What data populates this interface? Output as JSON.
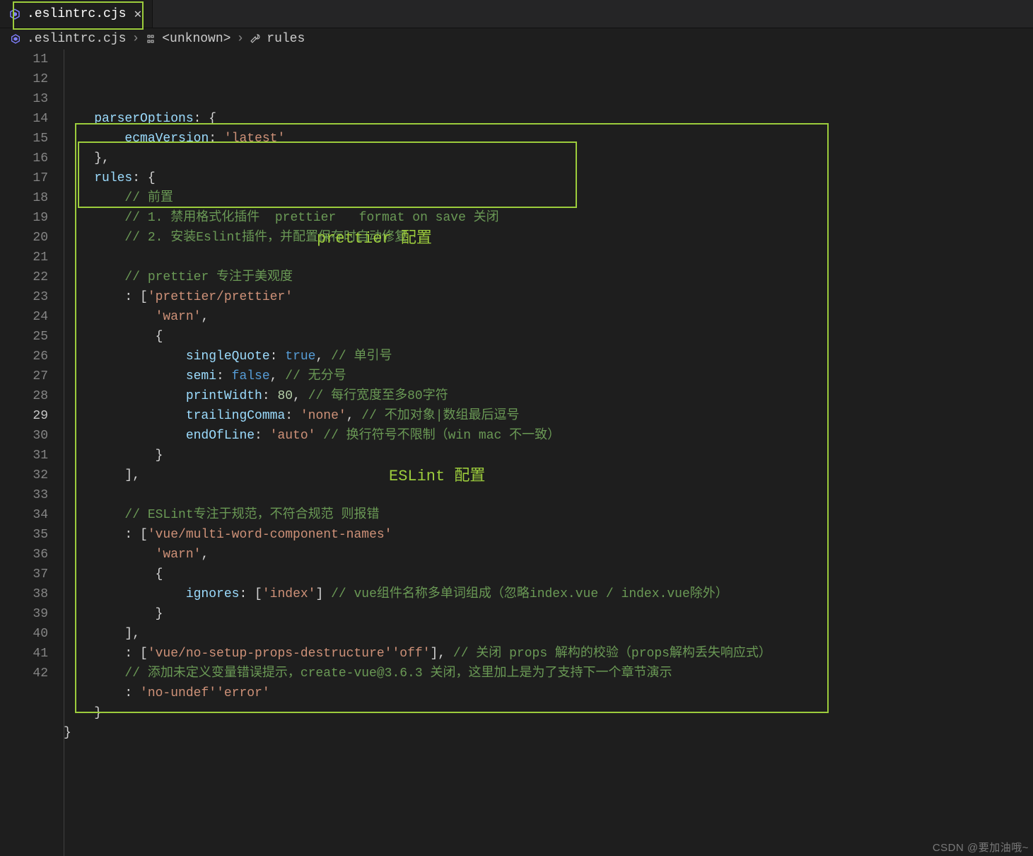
{
  "tab": {
    "filename": ".eslintrc.cjs"
  },
  "breadcrumbs": {
    "file": ".eslintrc.cjs",
    "scope": "<unknown>",
    "prop": "rules"
  },
  "lineStart": 11,
  "lineEnd": 42,
  "annotations": {
    "prettier_label": "prettier 配置",
    "eslint_label": "ESLint 配置"
  },
  "watermark": "CSDN @要加油哦~",
  "code": {
    "l11": {
      "indent": "  ",
      "prop": "parserOptions",
      "after": ": {"
    },
    "l12": {
      "indent": "    ",
      "prop": "ecmaVersion",
      "after": ": ",
      "str": "'latest'"
    },
    "l13": {
      "indent": "  ",
      "text": "},"
    },
    "l14": {
      "indent": "  ",
      "prop": "rules",
      "after": ": {"
    },
    "l15": {
      "indent": "    ",
      "comment": "// 前置"
    },
    "l16": {
      "indent": "    ",
      "comment": "// 1. 禁用格式化插件  prettier   format on save 关闭"
    },
    "l17": {
      "indent": "    ",
      "comment": "// 2. 安装Eslint插件，并配置保存时自动修复"
    },
    "l19": {
      "indent": "    ",
      "comment": "// prettier 专注于美观度"
    },
    "l20": {
      "indent": "    ",
      "str": "'prettier/prettier'",
      "after": ": ["
    },
    "l21": {
      "indent": "      ",
      "str": "'warn'",
      "after2": ","
    },
    "l22": {
      "indent": "      ",
      "text": "{"
    },
    "l23": {
      "indent": "        ",
      "prop": "singleQuote",
      "after": ": ",
      "kw": "true",
      "after2": ", ",
      "comment": "// 单引号"
    },
    "l24": {
      "indent": "        ",
      "prop": "semi",
      "after": ": ",
      "kw": "false",
      "after2": ", ",
      "comment": "// 无分号"
    },
    "l25": {
      "indent": "        ",
      "prop": "printWidth",
      "after": ": ",
      "num": "80",
      "after2": ", ",
      "comment": "// 每行宽度至多80字符"
    },
    "l26": {
      "indent": "        ",
      "prop": "trailingComma",
      "after": ": ",
      "str": "'none'",
      "after2": ", ",
      "comment": "// 不加对象|数组最后逗号"
    },
    "l27": {
      "indent": "        ",
      "prop": "endOfLine",
      "after": ": ",
      "str": "'auto'",
      "after2": " ",
      "comment": "// 换行符号不限制（win mac 不一致）"
    },
    "l28": {
      "indent": "      ",
      "text": "}"
    },
    "l29": {
      "indent": "    ",
      "text": "],"
    },
    "l31": {
      "indent": "    ",
      "comment": "// ESLint专注于规范，不符合规范 则报错"
    },
    "l32": {
      "indent": "    ",
      "str": "'vue/multi-word-component-names'",
      "after": ": ["
    },
    "l33": {
      "indent": "      ",
      "str": "'warn'",
      "after2": ","
    },
    "l34": {
      "indent": "      ",
      "text": "{"
    },
    "l35": {
      "indent": "        ",
      "prop": "ignores",
      "after": ": [",
      "str": "'index'",
      "after2": "] ",
      "comment": "// vue组件名称多单词组成（忽略index.vue / index.vue除外）"
    },
    "l36": {
      "indent": "      ",
      "text": "}"
    },
    "l37": {
      "indent": "    ",
      "text": "],"
    },
    "l38": {
      "indent": "    ",
      "str": "'vue/no-setup-props-destructure'",
      "after": ": [",
      "str2": "'off'",
      "after2": "], ",
      "comment": "// 关闭 props 解构的校验（props解构丢失响应式）"
    },
    "l39": {
      "indent": "    ",
      "comment": "// 添加未定义变量错误提示，create-vue@3.6.3 关闭，这里加上是为了支持下一个章节演示"
    },
    "l40": {
      "indent": "    ",
      "str": "'no-undef'",
      "after": ": ",
      "str2": "'error'"
    },
    "l41": {
      "indent": "  ",
      "text": "}"
    },
    "l42": {
      "indent": "",
      "text": "}"
    }
  }
}
